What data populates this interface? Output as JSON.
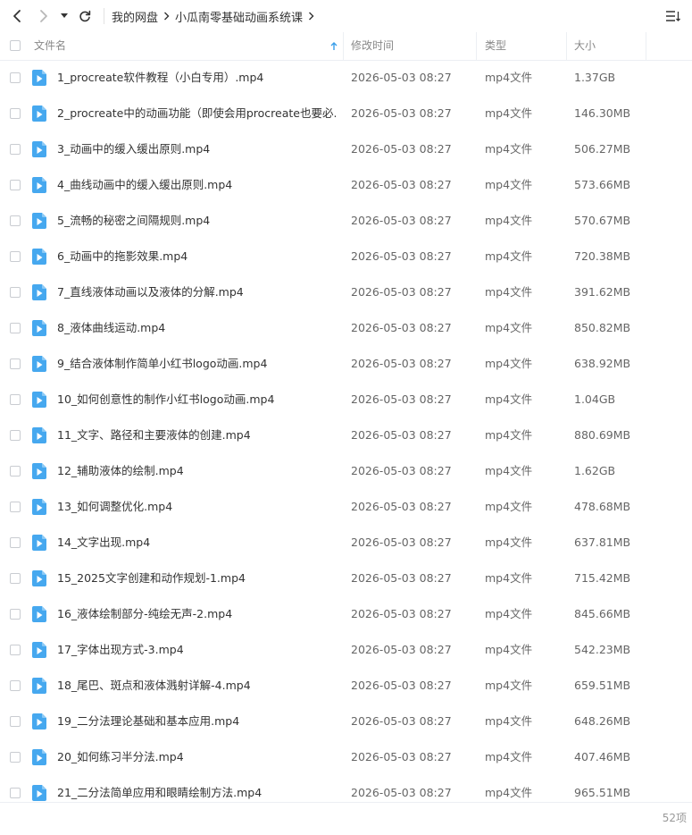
{
  "breadcrumb": [
    "我的网盘",
    "小瓜南零基础动画系统课"
  ],
  "columns": {
    "name": "文件名",
    "modified": "修改时间",
    "type": "类型",
    "size": "大小"
  },
  "colors": {
    "accent": "#3a9ee9",
    "file_icon": "#46a8ef",
    "border": "#eceff3"
  },
  "icons": {
    "back": "chevron-left-icon",
    "forward": "chevron-right-icon",
    "dropdown": "caret-down-icon",
    "refresh": "refresh-icon",
    "view": "list-view-icon",
    "sort": "sort-arrow-up-icon",
    "file": "video-file-icon"
  },
  "files": [
    {
      "name": "1_procreate软件教程（小白专用）.mp4",
      "modified": "2026-05-03 08:27",
      "type": "mp4文件",
      "size": "1.37GB"
    },
    {
      "name": "2_procreate中的动画功能（即使会用procreate也要必...",
      "modified": "2026-05-03 08:27",
      "type": "mp4文件",
      "size": "146.30MB"
    },
    {
      "name": "3_动画中的缓入缓出原则.mp4",
      "modified": "2026-05-03 08:27",
      "type": "mp4文件",
      "size": "506.27MB"
    },
    {
      "name": "4_曲线动画中的缓入缓出原则.mp4",
      "modified": "2026-05-03 08:27",
      "type": "mp4文件",
      "size": "573.66MB"
    },
    {
      "name": "5_流畅的秘密之间隔规则.mp4",
      "modified": "2026-05-03 08:27",
      "type": "mp4文件",
      "size": "570.67MB"
    },
    {
      "name": "6_动画中的拖影效果.mp4",
      "modified": "2026-05-03 08:27",
      "type": "mp4文件",
      "size": "720.38MB"
    },
    {
      "name": "7_直线液体动画以及液体的分解.mp4",
      "modified": "2026-05-03 08:27",
      "type": "mp4文件",
      "size": "391.62MB"
    },
    {
      "name": "8_液体曲线运动.mp4",
      "modified": "2026-05-03 08:27",
      "type": "mp4文件",
      "size": "850.82MB"
    },
    {
      "name": "9_结合液体制作简单小红书logo动画.mp4",
      "modified": "2026-05-03 08:27",
      "type": "mp4文件",
      "size": "638.92MB"
    },
    {
      "name": "10_如何创意性的制作小红书logo动画.mp4",
      "modified": "2026-05-03 08:27",
      "type": "mp4文件",
      "size": "1.04GB"
    },
    {
      "name": "11_文字、路径和主要液体的创建.mp4",
      "modified": "2026-05-03 08:27",
      "type": "mp4文件",
      "size": "880.69MB"
    },
    {
      "name": "12_辅助液体的绘制.mp4",
      "modified": "2026-05-03 08:27",
      "type": "mp4文件",
      "size": "1.62GB"
    },
    {
      "name": "13_如何调整优化.mp4",
      "modified": "2026-05-03 08:27",
      "type": "mp4文件",
      "size": "478.68MB"
    },
    {
      "name": "14_文字出现.mp4",
      "modified": "2026-05-03 08:27",
      "type": "mp4文件",
      "size": "637.81MB"
    },
    {
      "name": "15_2025文字创建和动作规划-1.mp4",
      "modified": "2026-05-03 08:27",
      "type": "mp4文件",
      "size": "715.42MB"
    },
    {
      "name": "16_液体绘制部分-纯绘无声-2.mp4",
      "modified": "2026-05-03 08:27",
      "type": "mp4文件",
      "size": "845.66MB"
    },
    {
      "name": "17_字体出现方式-3.mp4",
      "modified": "2026-05-03 08:27",
      "type": "mp4文件",
      "size": "542.23MB"
    },
    {
      "name": "18_尾巴、斑点和液体溅射详解-4.mp4",
      "modified": "2026-05-03 08:27",
      "type": "mp4文件",
      "size": "659.51MB"
    },
    {
      "name": "19_二分法理论基础和基本应用.mp4",
      "modified": "2026-05-03 08:27",
      "type": "mp4文件",
      "size": "648.26MB"
    },
    {
      "name": "20_如何练习半分法.mp4",
      "modified": "2026-05-03 08:27",
      "type": "mp4文件",
      "size": "407.46MB"
    },
    {
      "name": "21_二分法简单应用和眼睛绘制方法.mp4",
      "modified": "2026-05-03 08:27",
      "type": "mp4文件",
      "size": "965.51MB"
    }
  ],
  "footer": {
    "count": "52项"
  }
}
